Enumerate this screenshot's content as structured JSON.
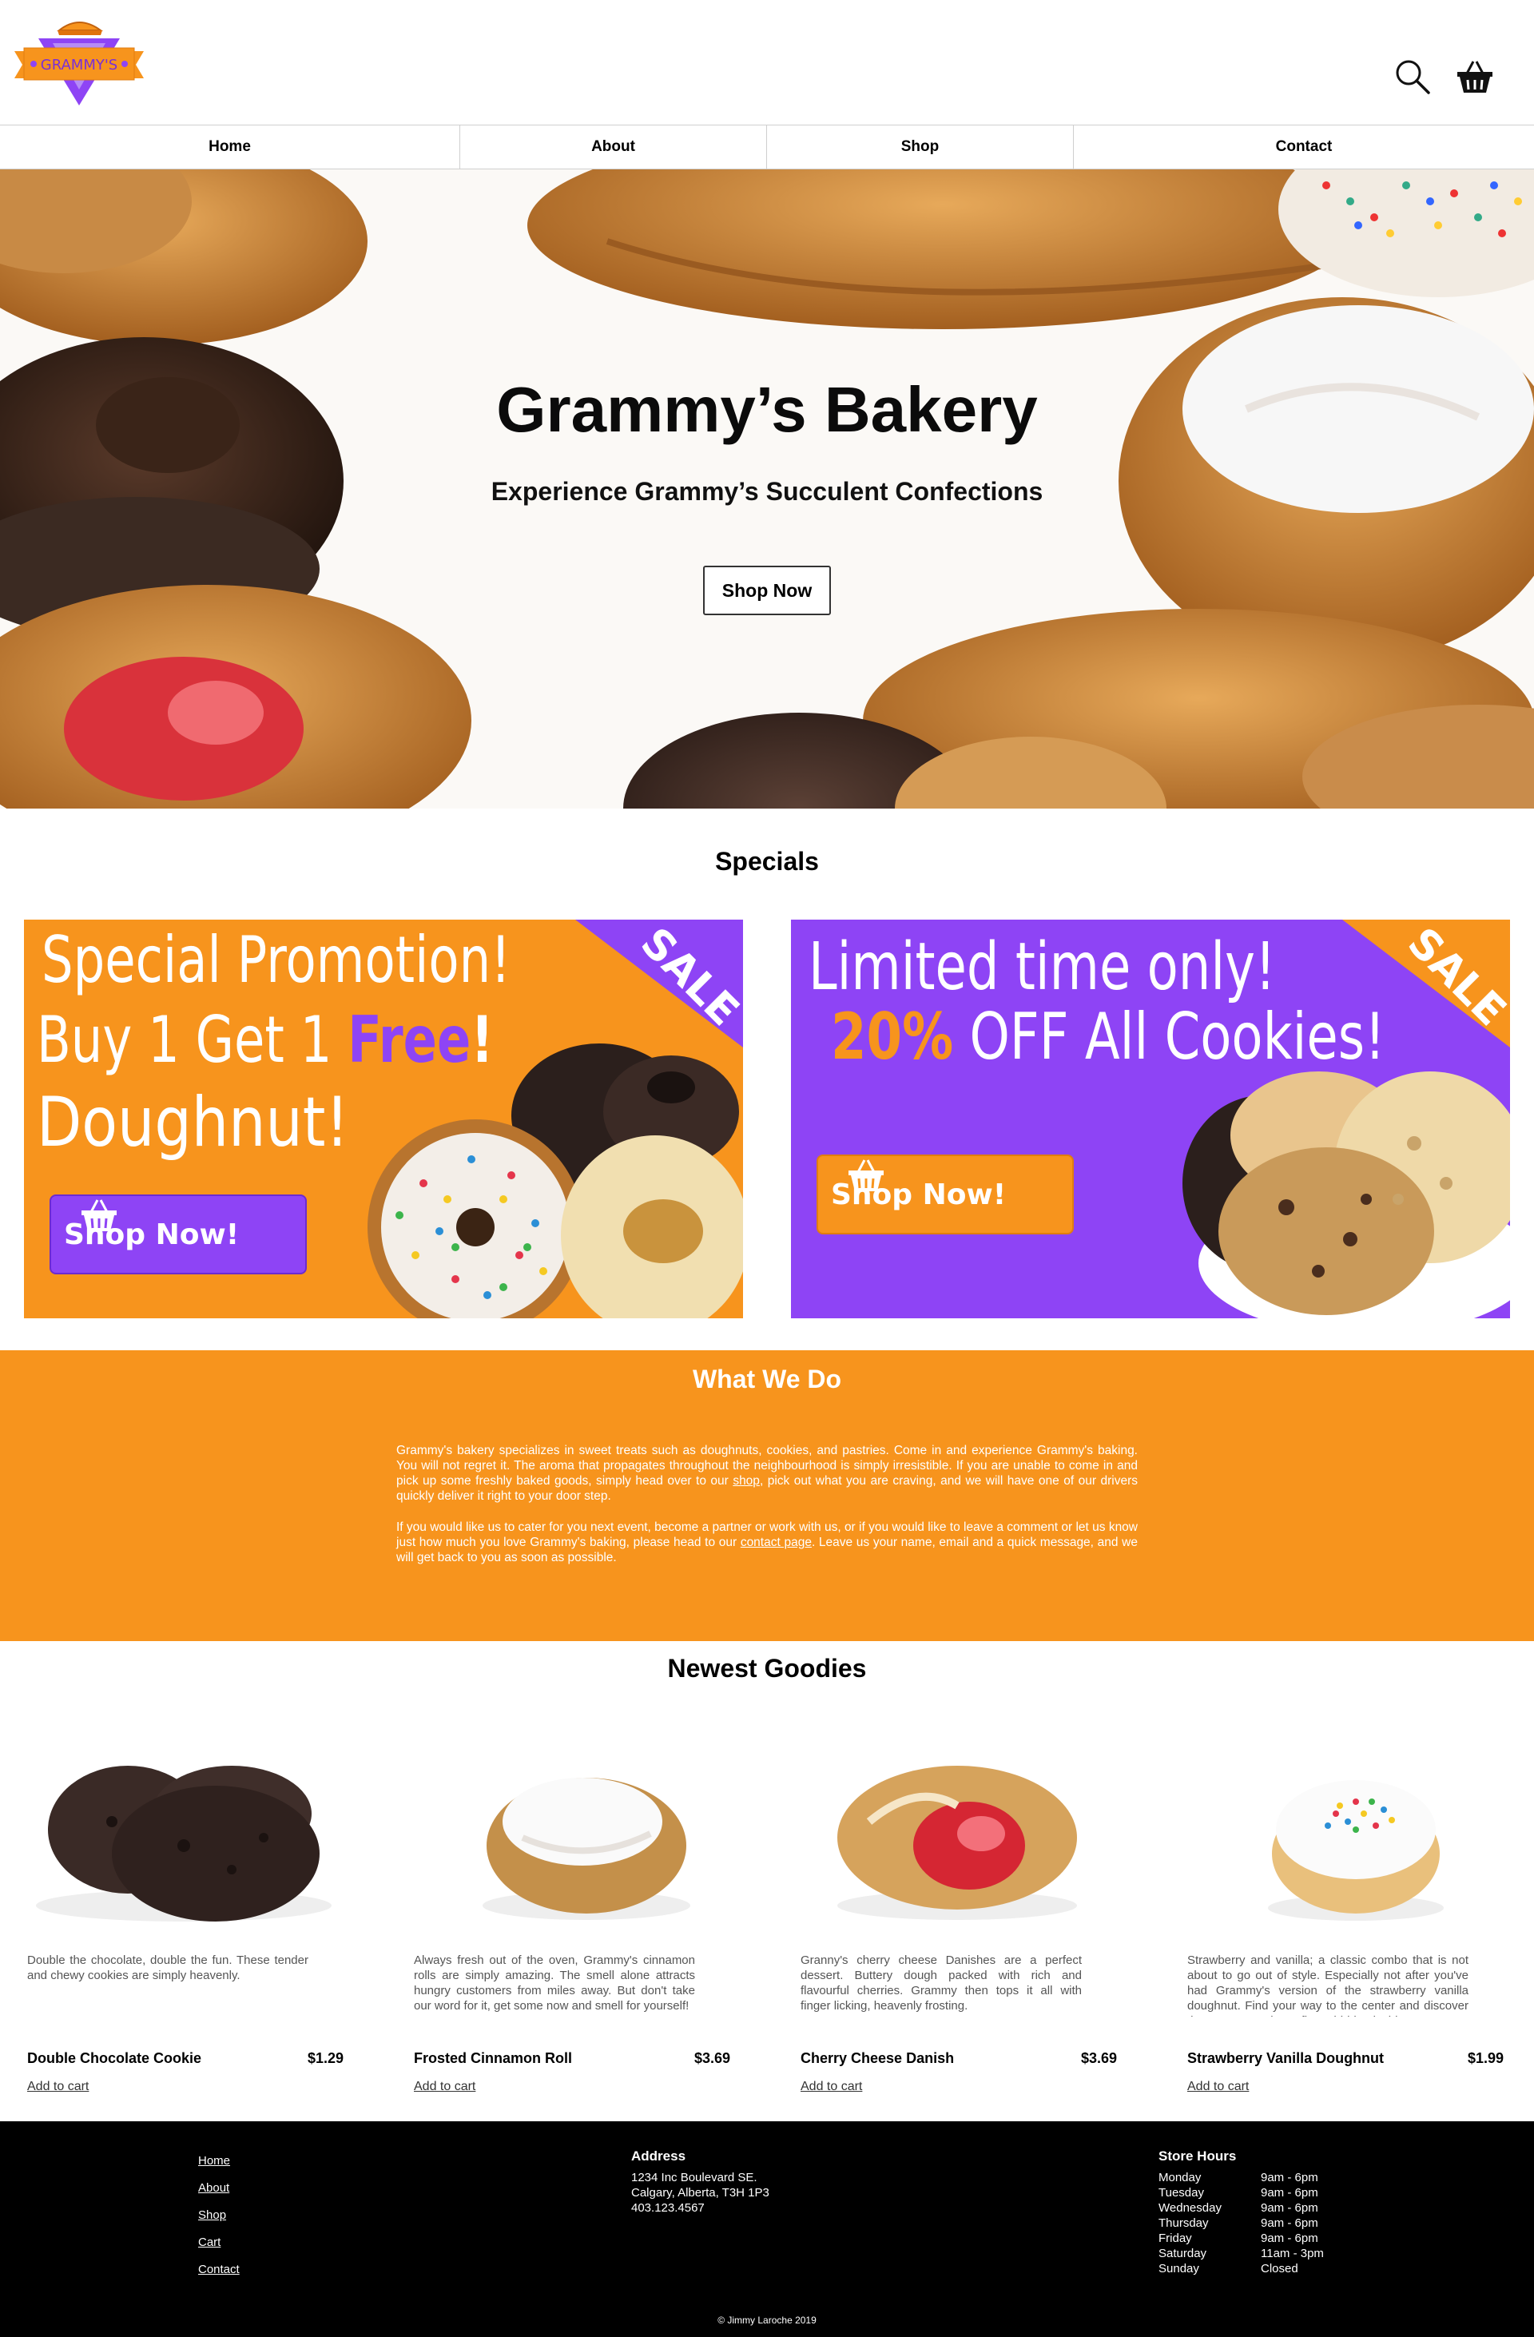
{
  "brand": {
    "logo_text": "GRAMMY'S"
  },
  "header": {
    "search_icon": "search-icon",
    "cart_icon": "basket-icon"
  },
  "nav": [
    {
      "label": "Home"
    },
    {
      "label": "About"
    },
    {
      "label": "Shop"
    },
    {
      "label": "Contact"
    }
  ],
  "hero": {
    "title": "Grammy’s Bakery",
    "subtitle": "Experience Grammy’s Succulent Confections",
    "button": "Shop Now"
  },
  "specials": {
    "title": "Specials",
    "promos": [
      {
        "badge": "SALE",
        "line1": "Special Promotion!",
        "line2_prefix": "Buy 1 Get 1 ",
        "line2_highlight": "Free",
        "line2_suffix": "!",
        "line3": "Doughnut!",
        "cta": "Shop Now!"
      },
      {
        "badge": "SALE",
        "line1": "Limited time only!",
        "line2_highlight": "20%",
        "line2_suffix": " OFF All Cookies!",
        "cta": "Shop Now!"
      }
    ]
  },
  "what_we_do": {
    "title": "What We Do",
    "p1_before": "Grammy's bakery specializes in sweet treats such as doughnuts, cookies, and pastries. Come in and experience Grammy's baking. You will not regret it. The aroma that propagates throughout the neighbourhood is simply irresistible. If you are unable to come in and pick up some freshly baked goods, simply head over to our ",
    "p1_link": "shop",
    "p1_after": ", pick out what you are craving, and we will have one of our drivers quickly deliver it right to your door step.",
    "p2_before": "If you would like us to cater for you next event, become a partner or work with us, or if you would like to leave a comment or let us know just how much you love Grammy's baking, please head to our ",
    "p2_link": "contact page",
    "p2_after": ". Leave us your name, email and a quick message, and we will get back to you as soon as possible."
  },
  "goodies": {
    "title": "Newest Goodies",
    "add_label": "Add to cart",
    "items": [
      {
        "name": "Double Chocolate Cookie",
        "price": "$1.29",
        "desc": "Double the chocolate, double the fun. These tender and chewy cookies are simply heavenly."
      },
      {
        "name": "Frosted Cinnamon Roll",
        "price": "$3.69",
        "desc": "Always fresh out of the oven, Grammy's cinnamon rolls are simply amazing. The smell alone attracts hungry customers from miles away. But don't take our word for it, get some now and smell for yourself!"
      },
      {
        "name": "Cherry Cheese Danish",
        "price": "$3.69",
        "desc": "Granny's cherry cheese Danishes are a perfect dessert. Buttery dough packed with rich and flavourful cherries. Grammy then tops it all with finger licking, heavenly frosting."
      },
      {
        "name": "Strawberry Vanilla Doughnut",
        "price": "$1.99",
        "desc": "Strawberry and vanilla; a classic combo that is not about to go out of style. Especially not after you've had Grammy's version of the strawberry vanilla doughnut. Find your way to the center and discover the sweet strawberry flavor hidden inside."
      }
    ]
  },
  "footer": {
    "links": [
      "Home",
      "About",
      "Shop",
      "Cart",
      "Contact"
    ],
    "address_title": "Address",
    "address_lines": [
      "1234 Inc Boulevard SE.",
      "Calgary, Alberta, T3H 1P3",
      "403.123.4567"
    ],
    "hours_title": "Store Hours",
    "hours": [
      {
        "day": "Monday",
        "time": "9am - 6pm"
      },
      {
        "day": "Tuesday",
        "time": "9am - 6pm"
      },
      {
        "day": "Wednesday",
        "time": "9am - 6pm"
      },
      {
        "day": "Thursday",
        "time": "9am - 6pm"
      },
      {
        "day": "Friday",
        "time": "9am - 6pm"
      },
      {
        "day": "Saturday",
        "time": "11am - 3pm"
      },
      {
        "day": "Sunday",
        "time": "Closed"
      }
    ],
    "copyright": "© Jimmy Laroche 2019"
  },
  "colors": {
    "orange": "#f7941d",
    "purple": "#8e44f5",
    "footer": "#000000"
  }
}
